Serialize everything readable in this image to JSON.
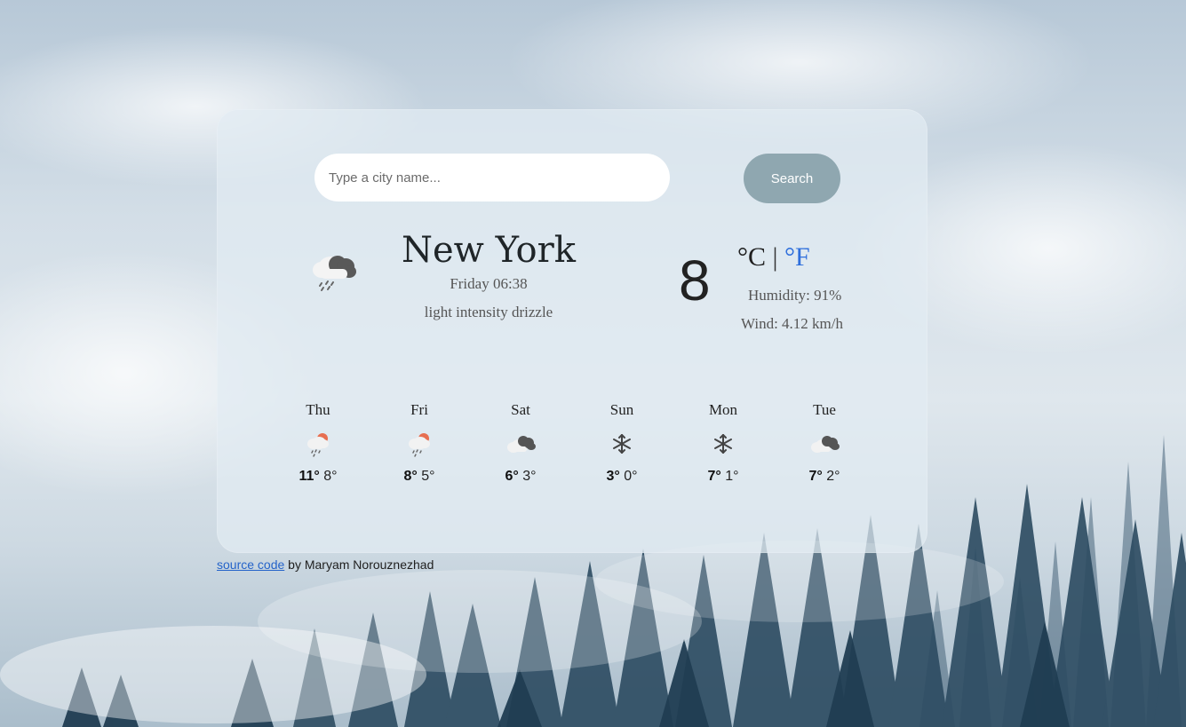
{
  "search": {
    "placeholder": "Type a city name...",
    "button_label": "Search"
  },
  "current": {
    "icon": "rain-cloud-icon",
    "city": "New York",
    "datetime": "Friday 06:38",
    "description": "light intensity drizzle",
    "temperature": "8",
    "unit_celsius": "°C",
    "unit_separator": "|",
    "unit_fahrenheit": "°F",
    "humidity": "Humidity: 91%",
    "wind": "Wind: 4.12 km/h"
  },
  "forecast": [
    {
      "day": "Thu",
      "icon": "drizzle-sun-icon",
      "max": "11°",
      "min": "8°"
    },
    {
      "day": "Fri",
      "icon": "drizzle-sun-icon",
      "max": "8°",
      "min": "5°"
    },
    {
      "day": "Sat",
      "icon": "cloudy-icon",
      "max": "6°",
      "min": "3°"
    },
    {
      "day": "Sun",
      "icon": "snow-icon",
      "max": "3°",
      "min": "0°"
    },
    {
      "day": "Mon",
      "icon": "snow-icon",
      "max": "7°",
      "min": "1°"
    },
    {
      "day": "Tue",
      "icon": "cloudy-icon",
      "max": "7°",
      "min": "2°"
    }
  ],
  "footer": {
    "link_text": "source code",
    "author_text": " by Maryam Norouznezhad"
  },
  "colors": {
    "search_button": "#8fa7b0",
    "fahrenheit_link": "#2f6fdc",
    "footer_link": "#2563c9"
  }
}
